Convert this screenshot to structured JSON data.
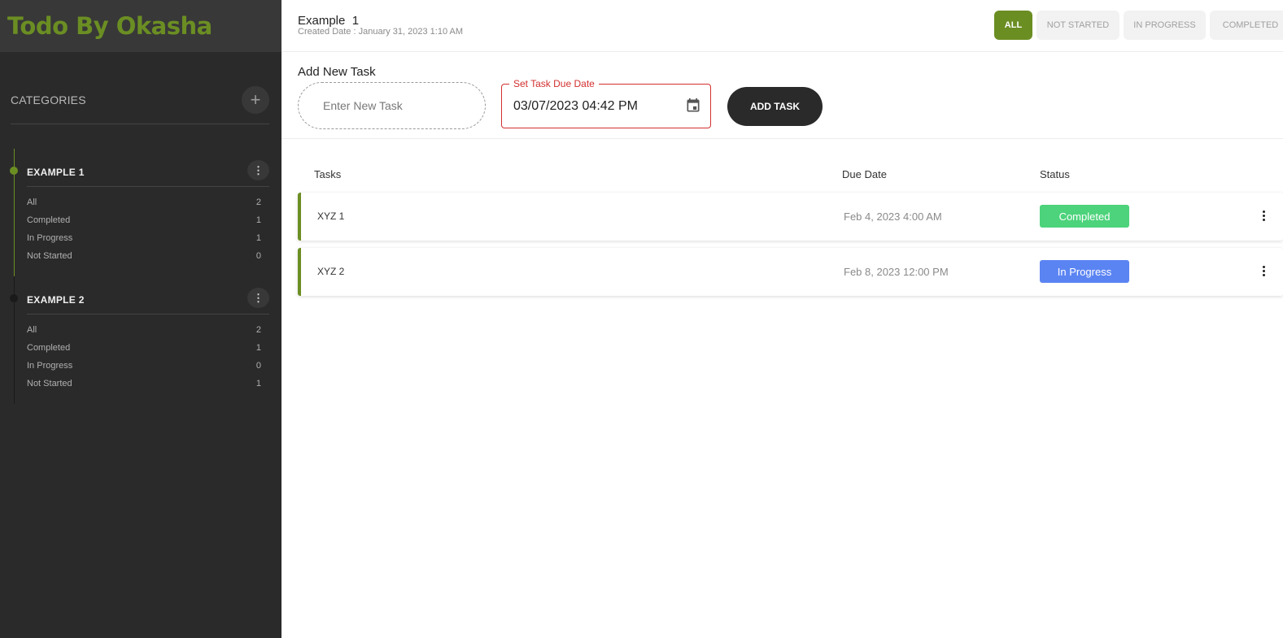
{
  "app": {
    "title": "Todo By Okasha",
    "brand_color": "#6b8e23"
  },
  "sidebar": {
    "categories_label": "CATEGORIES",
    "add_category_icon": "plus-icon",
    "categories": [
      {
        "name": "EXAMPLE 1",
        "active": true,
        "stats": [
          {
            "label": "All",
            "count": "2"
          },
          {
            "label": "Completed",
            "count": "1"
          },
          {
            "label": "In Progress",
            "count": "1"
          },
          {
            "label": "Not Started",
            "count": "0"
          }
        ]
      },
      {
        "name": "EXAMPLE 2",
        "active": false,
        "stats": [
          {
            "label": "All",
            "count": "2"
          },
          {
            "label": "Completed",
            "count": "1"
          },
          {
            "label": "In Progress",
            "count": "0"
          },
          {
            "label": "Not Started",
            "count": "1"
          }
        ]
      }
    ]
  },
  "header": {
    "title": "Example  1",
    "created_date": "Created Date : January 31, 2023 1:10 AM",
    "filters": [
      {
        "label": "ALL",
        "active": true
      },
      {
        "label": "NOT STARTED",
        "active": false
      },
      {
        "label": "IN PROGRESS",
        "active": false
      },
      {
        "label": "COMPLETED",
        "active": false
      }
    ]
  },
  "add_task": {
    "title": "Add New Task",
    "input_placeholder": "Enter New Task",
    "input_value": "",
    "due_date_label": "Set Task Due Date",
    "due_date_value": "03/07/2023 04:42 PM",
    "button_label": "ADD TASK"
  },
  "table": {
    "columns": {
      "tasks": "Tasks",
      "due_date": "Due Date",
      "status": "Status"
    },
    "rows": [
      {
        "name": "XYZ 1",
        "due_date": "Feb 4, 2023 4:00 AM",
        "status": "Completed",
        "status_color": "#4cd37b"
      },
      {
        "name": "XYZ 2",
        "due_date": "Feb 8, 2023 12:00 PM",
        "status": "In Progress",
        "status_color": "#5b84f3"
      }
    ]
  }
}
